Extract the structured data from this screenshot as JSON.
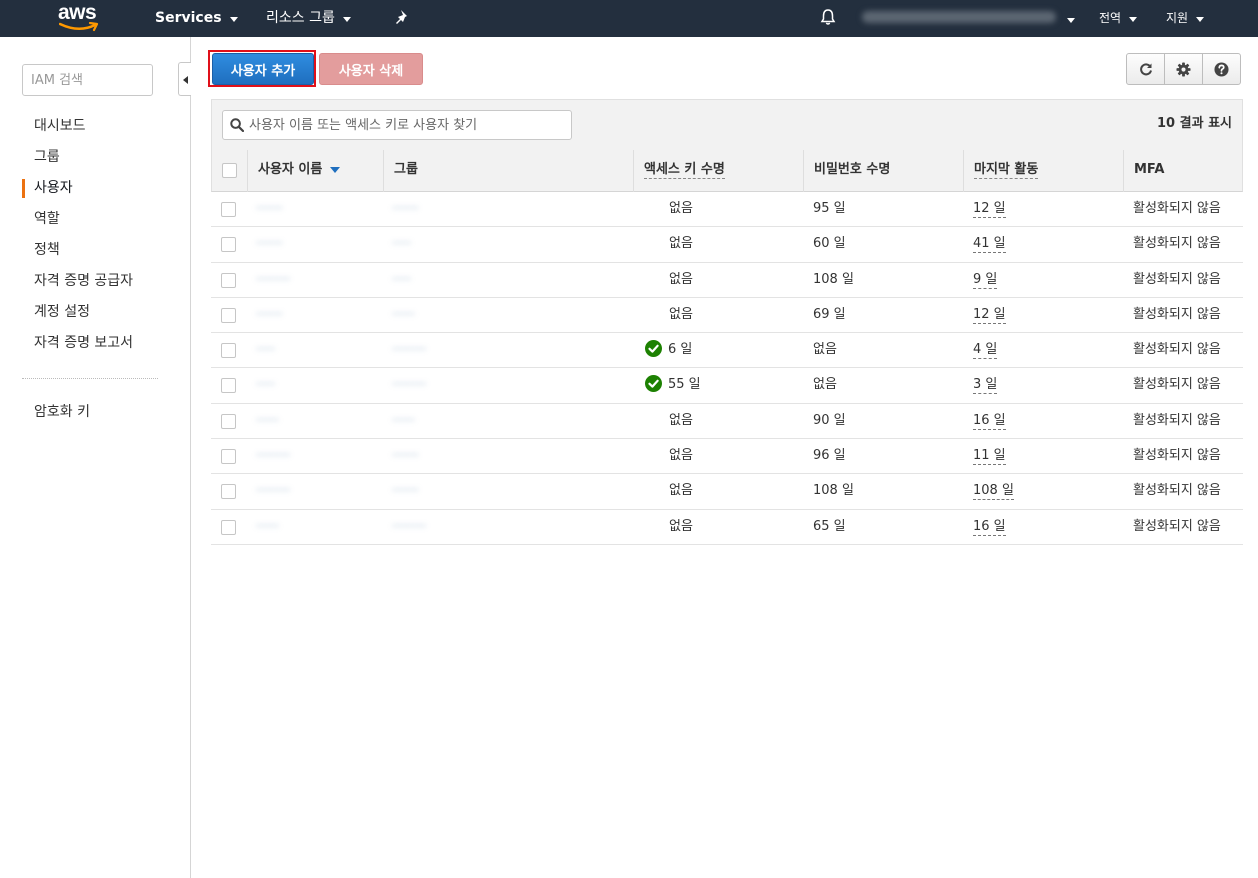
{
  "topbar": {
    "logo_text": "aws",
    "services_label": "Services",
    "resource_groups_label": "리소스 그룹",
    "pin_icon": "pin-icon",
    "bell_icon": "bell-icon",
    "region_label": "전역",
    "support_label": "지원"
  },
  "sidebar": {
    "search_placeholder": "IAM 검색",
    "items": [
      {
        "label": "대시보드"
      },
      {
        "label": "그룹"
      },
      {
        "label": "사용자"
      },
      {
        "label": "역할"
      },
      {
        "label": "정책"
      },
      {
        "label": "자격 증명 공급자"
      },
      {
        "label": "계정 설정"
      },
      {
        "label": "자격 증명 보고서"
      }
    ],
    "encryption_keys_label": "암호화 키"
  },
  "actions": {
    "add_user_label": "사용자 추가",
    "delete_user_label": "사용자 삭제",
    "refresh_icon": "refresh-icon",
    "settings_icon": "gear-icon",
    "help_icon": "help-icon"
  },
  "filter": {
    "placeholder": "사용자 이름 또는 액세스 키로 사용자 찾기",
    "result_count": "10 결과 표시"
  },
  "table": {
    "columns": {
      "username": "사용자 이름",
      "groups": "그룹",
      "access_key_age": "액세스 키 수명",
      "password_age": "비밀번호 수명",
      "last_activity": "마지막 활동",
      "mfa": "MFA"
    },
    "rows": [
      {
        "access_key_age": "없음",
        "password_age": "95 일",
        "last_activity": "12 일",
        "mfa": "활성화되지 않음"
      },
      {
        "access_key_age": "없음",
        "password_age": "60 일",
        "last_activity": "41 일",
        "mfa": "활성화되지 않음"
      },
      {
        "access_key_age": "없음",
        "password_age": "108 일",
        "last_activity": "9 일",
        "mfa": "활성화되지 않음"
      },
      {
        "access_key_age": "없음",
        "password_age": "69 일",
        "last_activity": "12 일",
        "mfa": "활성화되지 않음"
      },
      {
        "access_key_age": "6 일",
        "access_key_active": true,
        "password_age": "없음",
        "last_activity": "4 일",
        "mfa": "활성화되지 않음"
      },
      {
        "access_key_age": "55 일",
        "access_key_active": true,
        "password_age": "없음",
        "last_activity": "3 일",
        "mfa": "활성화되지 않음"
      },
      {
        "access_key_age": "없음",
        "password_age": "90 일",
        "last_activity": "16 일",
        "mfa": "활성화되지 않음"
      },
      {
        "access_key_age": "없음",
        "password_age": "96 일",
        "last_activity": "11 일",
        "mfa": "활성화되지 않음"
      },
      {
        "access_key_age": "없음",
        "password_age": "108 일",
        "last_activity": "108 일",
        "mfa": "활성화되지 않음"
      },
      {
        "access_key_age": "없음",
        "password_age": "65 일",
        "last_activity": "16 일",
        "mfa": "활성화되지 않음"
      }
    ]
  },
  "colors": {
    "topbar_bg": "#232f3e",
    "aws_orange": "#ec7211",
    "primary_blue": "#1f6fbf",
    "danger_disabled": "#e39d9d",
    "check_green": "#1d8102",
    "highlight_red": "#e0101a"
  }
}
